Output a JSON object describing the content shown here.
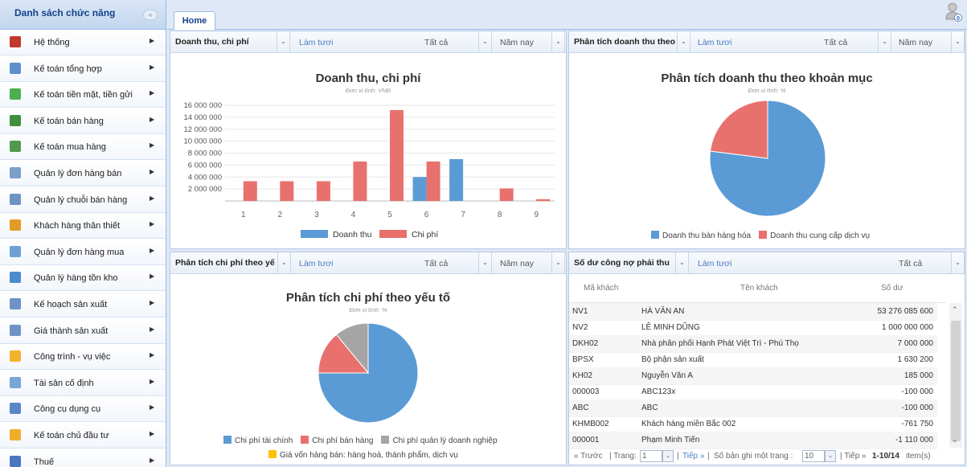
{
  "sidebar": {
    "title": "Danh sách chức năng",
    "items": [
      {
        "label": "Hệ thống",
        "icon": "tools-icon"
      },
      {
        "label": "Kế toán tổng hợp",
        "icon": "ledger-icon"
      },
      {
        "label": "Kế toán tiền mặt, tiền gửi",
        "icon": "cash-icon"
      },
      {
        "label": "Kế toán bán hàng",
        "icon": "sales-icon"
      },
      {
        "label": "Kế toán mua hàng",
        "icon": "purchase-icon"
      },
      {
        "label": "Quản lý đơn hàng bán",
        "icon": "sales-order-icon"
      },
      {
        "label": "Quản lý chuỗi bán hàng",
        "icon": "store-chain-icon"
      },
      {
        "label": "Khách hàng thân thiết",
        "icon": "loyal-customer-icon"
      },
      {
        "label": "Quản lý đơn hàng mua",
        "icon": "purchase-order-icon"
      },
      {
        "label": "Quản lý hàng tồn kho",
        "icon": "inventory-icon"
      },
      {
        "label": "Kế hoạch sản xuất",
        "icon": "production-plan-icon"
      },
      {
        "label": "Giá thành sản xuất",
        "icon": "production-cost-icon"
      },
      {
        "label": "Công trình - vụ việc",
        "icon": "project-folder-icon"
      },
      {
        "label": "Tài sản cố định",
        "icon": "fixed-asset-icon"
      },
      {
        "label": "Công cụ dụng cụ",
        "icon": "tools-equipment-icon"
      },
      {
        "label": "Kế toán chủ đầu tư",
        "icon": "investor-folder-icon"
      },
      {
        "label": "Thuế",
        "icon": "tax-icon"
      }
    ]
  },
  "tabs": {
    "home": "Home"
  },
  "common": {
    "refresh": "Làm tươi",
    "all": "Tất cả",
    "this_year": "Năm nay"
  },
  "panel_revenue": {
    "toolbar_title": "Doanh thu, chi phí",
    "chart_title": "Doanh thu, chi phí",
    "chart_subtitle": "Đơn vị tính: VNĐ"
  },
  "panel_revenue_analysis": {
    "toolbar_title": "Phân tích doanh thu theo",
    "chart_title": "Phân tích doanh thu theo khoản mục",
    "chart_subtitle": "Đơn vị tính: %"
  },
  "panel_cost_analysis": {
    "toolbar_title": "Phân tích chi phí theo yế",
    "chart_title": "Phân tích chi phí theo yếu tố",
    "chart_subtitle": "Đơn vị tính: %"
  },
  "panel_receivables": {
    "toolbar_title": "Số dư công nợ phải thu",
    "columns": [
      "Mã khách",
      "Tên khách",
      "Số dư"
    ],
    "rows": [
      [
        "NV1",
        "HÀ VĂN AN",
        "53 276 085 600"
      ],
      [
        "NV2",
        "LÊ MINH DŨNG",
        "1 000 000 000"
      ],
      [
        "DKH02",
        "Nhà phân phối Hạnh Phát Việt Trì - Phú Thọ",
        "7 000 000"
      ],
      [
        "BPSX",
        "Bộ phận sản xuất",
        "1 630 200"
      ],
      [
        "KH02",
        "Nguyễn Văn A",
        "185 000"
      ],
      [
        "000003",
        "ABC123x",
        "-100 000"
      ],
      [
        "ABC",
        "ABC",
        "-100 000"
      ],
      [
        "KHMB002",
        "Khách hàng miền Bắc 002",
        "-761 750"
      ],
      [
        "000001",
        "Phạm Minh Tiến",
        "-1 110 000"
      ]
    ],
    "pager": {
      "prev": "« Trước",
      "page_label": "| Trang:",
      "page_value": "1",
      "next": "Tiếp »",
      "per_page_label": "Số bản ghi một trang :",
      "per_page_value": "10",
      "summary_prefix": "| Tiếp »",
      "summary_range": "1-10/14",
      "summary_suffix": "item(s)"
    }
  },
  "chart_data": [
    {
      "type": "bar",
      "title": "Doanh thu, chi phí",
      "subtitle": "Đơn vị tính: VNĐ",
      "categories": [
        "1",
        "2",
        "3",
        "4",
        "5",
        "6",
        "7",
        "8",
        "9"
      ],
      "y_ticks": [
        "2 000 000",
        "4 000 000",
        "6 000 000",
        "8 000 000",
        "10 000 000",
        "12 000 000",
        "14 000 000",
        "16 000 000"
      ],
      "ylim": [
        0,
        16000000
      ],
      "series": [
        {
          "name": "Doanh thu",
          "color": "#5b9bd5",
          "values": [
            0,
            0,
            0,
            0,
            0,
            4000000,
            7000000,
            0,
            0
          ]
        },
        {
          "name": "Chi phí",
          "color": "#e8716e",
          "values": [
            3300000,
            3300000,
            3300000,
            6600000,
            15200000,
            6600000,
            0,
            2100000,
            300000
          ]
        }
      ],
      "legend": "bottom"
    },
    {
      "type": "pie",
      "title": "Phân tích doanh thu theo khoản mục",
      "subtitle": "Đơn vị tính: %",
      "slices": [
        {
          "name": "Doanh thu bán hàng hóa",
          "value": 77,
          "color": "#5b9bd5"
        },
        {
          "name": "Doanh thu cung cấp dịch vụ",
          "value": 23,
          "color": "#e8716e"
        }
      ],
      "legend": "bottom"
    },
    {
      "type": "pie",
      "title": "Phân tích chi phí theo yếu tố",
      "subtitle": "Đơn vị tính: %",
      "slices": [
        {
          "name": "Chi phí tài chính",
          "value": 75,
          "color": "#5b9bd5"
        },
        {
          "name": "Chi phí bán hàng",
          "value": 14,
          "color": "#e8716e"
        },
        {
          "name": "Chi phí quản lý doanh nghiệp",
          "value": 11,
          "color": "#a5a5a5"
        },
        {
          "name": "Giá vốn hàng bán: hàng hoá, thành phẩm, dịch vụ",
          "value": 0,
          "color": "#ffc000"
        }
      ],
      "legend": "bottom"
    }
  ]
}
